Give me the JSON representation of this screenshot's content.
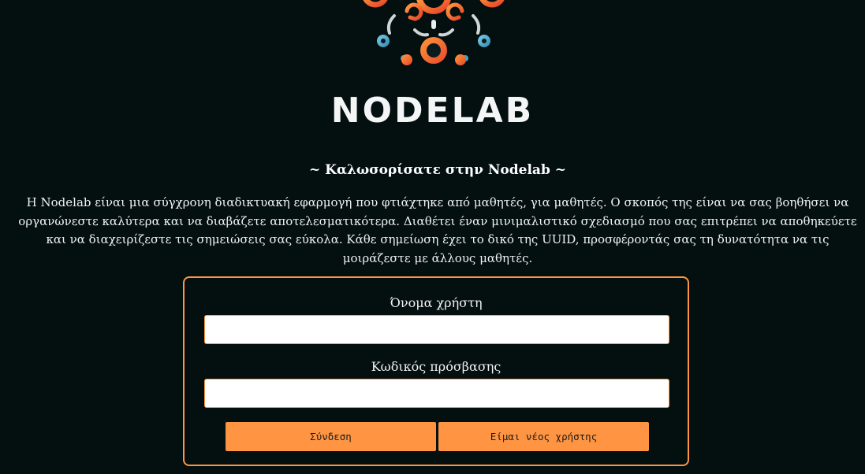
{
  "brand": {
    "logo_icon": "nodelab-network-logo-icon",
    "name": "NODELAB"
  },
  "welcome": {
    "title": "~ Καλωσορίσατε στην Nodelab ~",
    "intro": "Η Nodelab είναι μια σύγχρονη διαδικτυακή εφαρμογή που φτιάχτηκε από μαθητές, για μαθητές. Ο σκοπός της είναι να σας βοηθήσει να οργανώνεστε καλύτερα και να διαβάζετε αποτελεσματικότερα. Διαθέτει έναν μινιμαλιστικό σχεδιασμό που σας επιτρέπει να αποθηκεύετε και να διαχειρίζεστε τις σημειώσεις σας εύκολα. Κάθε σημείωση έχει το δικό της UUID, προσφέροντάς σας τη δυνατότητα να τις μοιράζεστε με άλλους μαθητές."
  },
  "login": {
    "username_label": "Όνομα χρήστη",
    "username_value": "",
    "password_label": "Κωδικός πρόσβασης",
    "password_value": "",
    "login_button": "Σύνδεση",
    "register_button": "Είμαι νέος χρήστης"
  },
  "colors": {
    "background": "#040f0f",
    "accent": "#ff9542",
    "logo_blue": "#3fa6c8"
  }
}
